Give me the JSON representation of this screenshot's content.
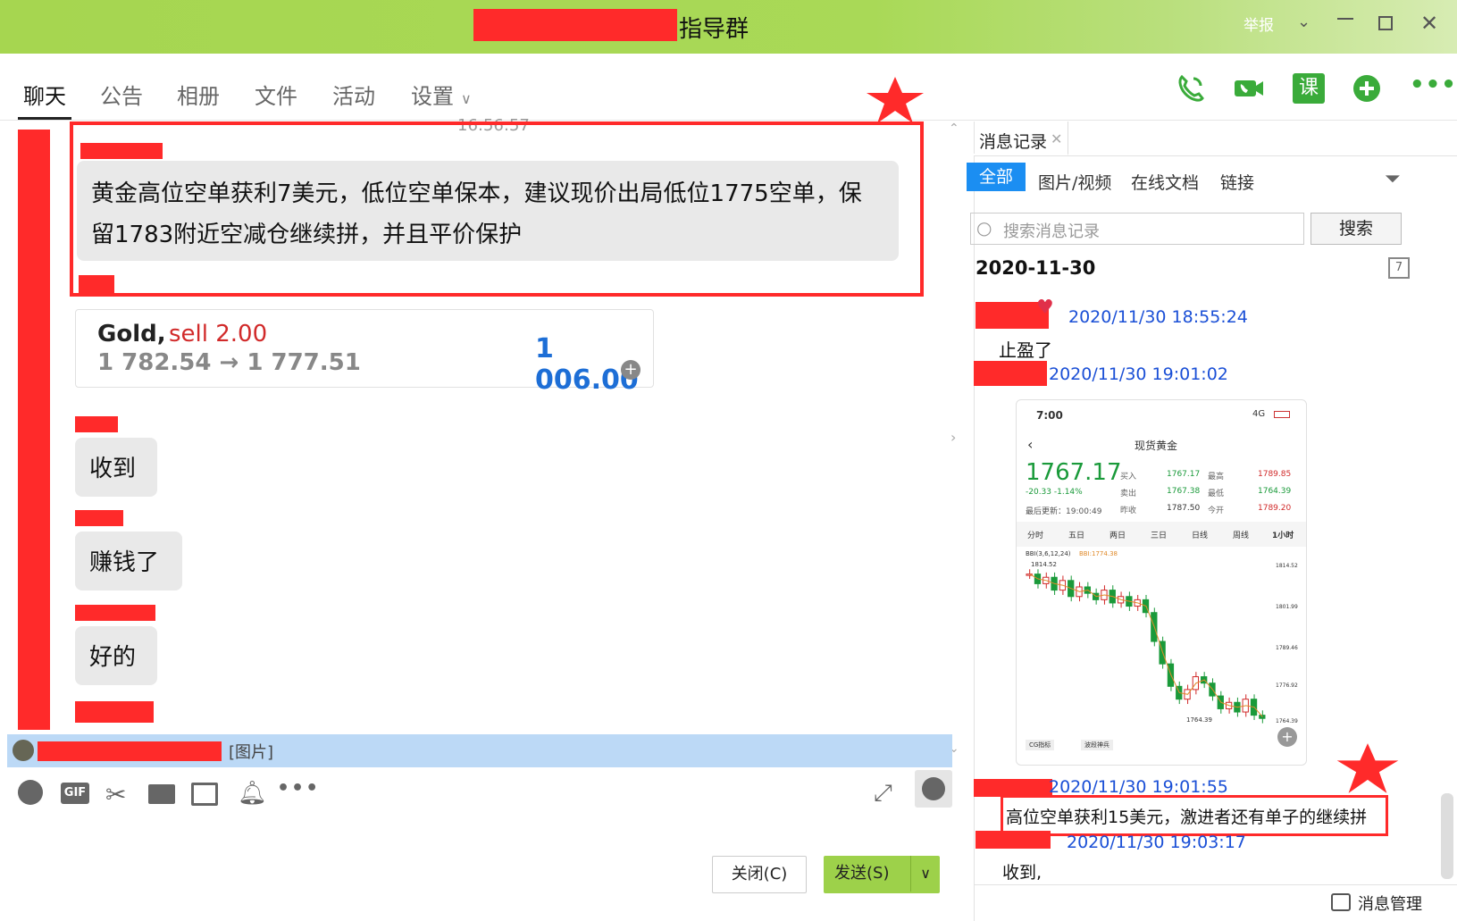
{
  "window": {
    "title": "指导群",
    "report_label": "举报",
    "controls": [
      "chevron-down-icon",
      "minimize-icon",
      "restore-icon",
      "close-icon"
    ]
  },
  "tabs": [
    {
      "label": "聊天",
      "active": true
    },
    {
      "label": "公告",
      "active": false
    },
    {
      "label": "相册",
      "active": false
    },
    {
      "label": "文件",
      "active": false
    },
    {
      "label": "活动",
      "active": false
    },
    {
      "label": "设置",
      "active": false
    }
  ],
  "header_icons": [
    "phone-icon",
    "video-icon",
    "lesson-icon",
    "add-app-icon",
    "more-icon"
  ],
  "header_icon_lesson_label": "课",
  "chat": {
    "timestamp": "16:56:57",
    "messages": [
      {
        "text": "黄金高位空单获利7美元，低位空单保本，建议现价出局低位1775空单，保留1783附近空减仓继续拼，并且平价保护"
      },
      {
        "text": "收到"
      },
      {
        "text": "赚钱了"
      },
      {
        "text": "好的"
      }
    ],
    "trade_card": {
      "symbol": "Gold,",
      "action": "sell 2.00",
      "prices": "1 782.54 → 1 777.51",
      "profit": "1 006.00"
    },
    "notice": "[图片]"
  },
  "buttons": {
    "close": "关闭(C)",
    "send": "发送(S)"
  },
  "history": {
    "tab_title": "消息记录",
    "filters": [
      "全部",
      "图片/视频",
      "在线文档",
      "链接"
    ],
    "active_filter": "全部",
    "search_placeholder": "搜索消息记录",
    "search_button": "搜索",
    "date": "2020-11-30",
    "entries": [
      {
        "time": "2020/11/30 18:55:24",
        "text": "止盈了"
      },
      {
        "time": "2020/11/30 19:01:02",
        "text": ""
      },
      {
        "time": "2020/11/30 19:01:55",
        "text": "高位空单获利15美元，激进者还有单子的继续拼"
      },
      {
        "time": "2020/11/30 19:03:17",
        "text": "收到,"
      }
    ],
    "manage_label": "消息管理"
  },
  "phone_shot": {
    "clock": "7:00",
    "network": "4G",
    "title": "现货黄金",
    "price": "1767.17",
    "change": "-20.33 -1.14%",
    "updated": "最后更新：19:00:49",
    "quotes": [
      {
        "label": "买入",
        "value": "1767.17"
      },
      {
        "label": "卖出",
        "value": "1767.38"
      },
      {
        "label": "昨收",
        "value": "1787.50"
      },
      {
        "label": "最高",
        "value": "1789.85"
      },
      {
        "label": "最低",
        "value": "1764.39"
      },
      {
        "label": "今开",
        "value": "1789.20"
      }
    ],
    "periods": [
      "分时",
      "五日",
      "两日",
      "三日",
      "日线",
      "周线",
      "1小时"
    ],
    "indicator": "BBI(3,6,12,24)",
    "indicator_value": "BBI:1774.38",
    "high_label": "1814.52",
    "low_label": "1764.39",
    "axis": [
      "1814.52",
      "1801.99",
      "1789.46",
      "1776.92",
      "1764.39"
    ],
    "footer": [
      "CG指标",
      "波段神兵"
    ],
    "candles": [
      1811,
      1808,
      1810,
      1806,
      1809,
      1804,
      1807,
      1805,
      1803,
      1806,
      1802,
      1804,
      1801,
      1803,
      1799,
      1790,
      1783,
      1776,
      1772,
      1775,
      1779,
      1777,
      1773,
      1769,
      1771,
      1768,
      1772,
      1767,
      1766
    ]
  }
}
